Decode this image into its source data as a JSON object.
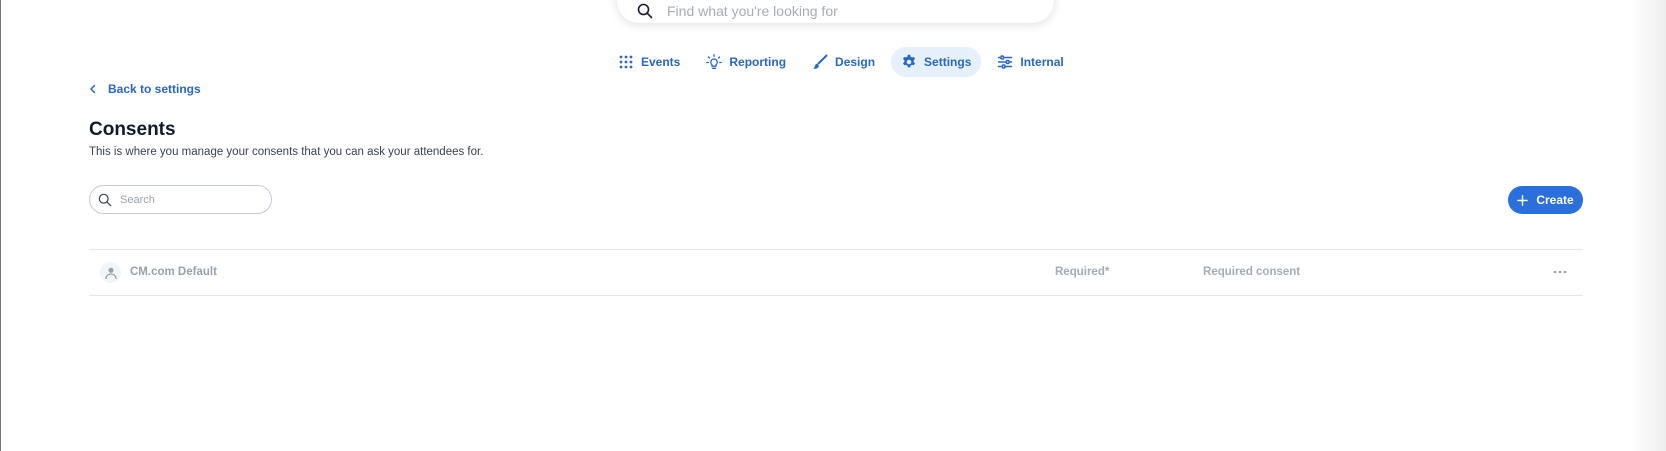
{
  "search": {
    "placeholder": "Find what you're looking for"
  },
  "nav": {
    "items": [
      {
        "label": "Events",
        "icon": "grid-icon"
      },
      {
        "label": "Reporting",
        "icon": "lightbulb-icon"
      },
      {
        "label": "Design",
        "icon": "brush-icon"
      },
      {
        "label": "Settings",
        "icon": "gear-icon",
        "active": true
      },
      {
        "label": "Internal",
        "icon": "sliders-icon"
      }
    ]
  },
  "back_link": {
    "label": "Back to settings"
  },
  "page": {
    "title": "Consents",
    "subtitle": "This is where you manage your consents that you can ask your attendees for."
  },
  "list_search": {
    "placeholder": "Search"
  },
  "create_button": {
    "label": "Create"
  },
  "consents": [
    {
      "name": "CM.com Default",
      "requirement": "Required*",
      "type": "Required consent"
    }
  ],
  "colors": {
    "accent": "#2a6fdc",
    "link": "#2767c9",
    "active_tab_bg": "#e6f0fb"
  }
}
